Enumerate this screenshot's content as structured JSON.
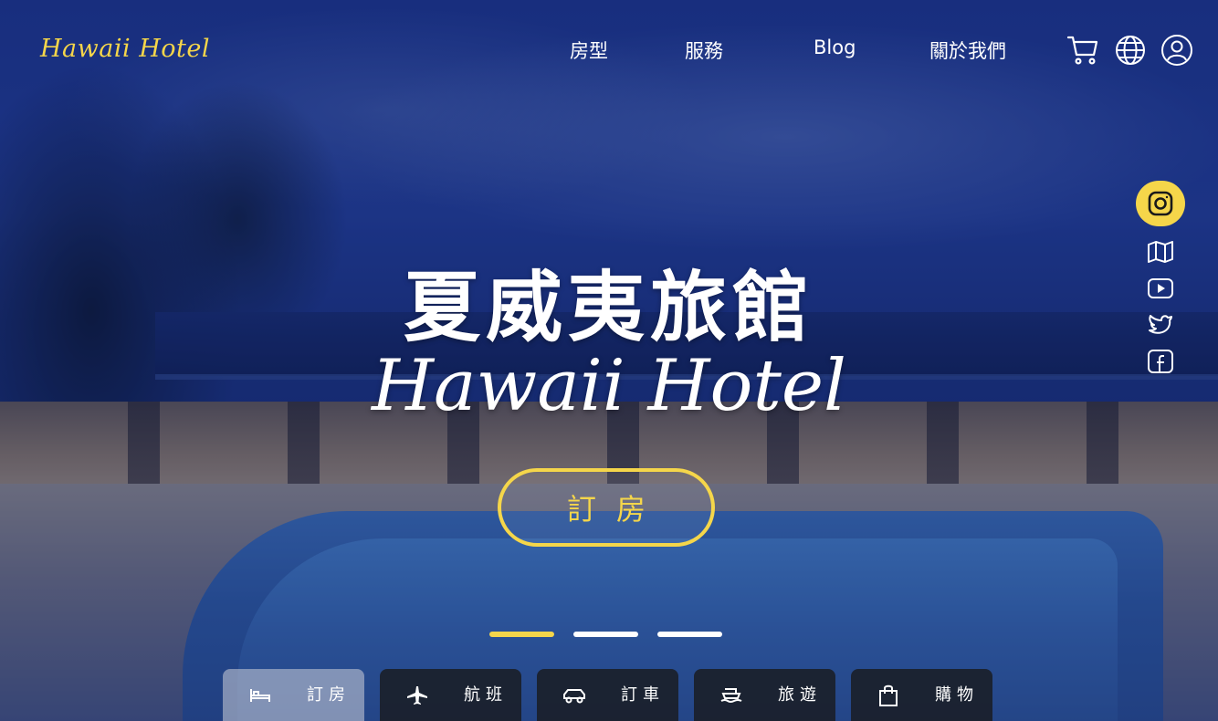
{
  "brand": {
    "logo": "Hawaii Hotel",
    "accent": "#f5d64a"
  },
  "nav": {
    "items": [
      {
        "label": "房型"
      },
      {
        "label": "服務"
      },
      {
        "label": "Blog"
      },
      {
        "label": "關於我們"
      }
    ],
    "icons": [
      "cart-icon",
      "globe-icon",
      "user-icon"
    ]
  },
  "social": [
    "instagram-icon",
    "map-icon",
    "youtube-icon",
    "twitter-icon",
    "facebook-icon"
  ],
  "hero": {
    "title_zh": "夏威夷旅館",
    "title_en": "Hawaii Hotel",
    "cta_label": "訂房"
  },
  "carousel": {
    "count": 3,
    "active": 0
  },
  "tabs": [
    {
      "label": "訂房",
      "icon": "bed-icon",
      "active": true
    },
    {
      "label": "航班",
      "icon": "plane-icon",
      "active": false
    },
    {
      "label": "訂車",
      "icon": "car-icon",
      "active": false
    },
    {
      "label": "旅遊",
      "icon": "ship-icon",
      "active": false
    },
    {
      "label": "購物",
      "icon": "shopping-bag-icon",
      "active": false
    }
  ]
}
